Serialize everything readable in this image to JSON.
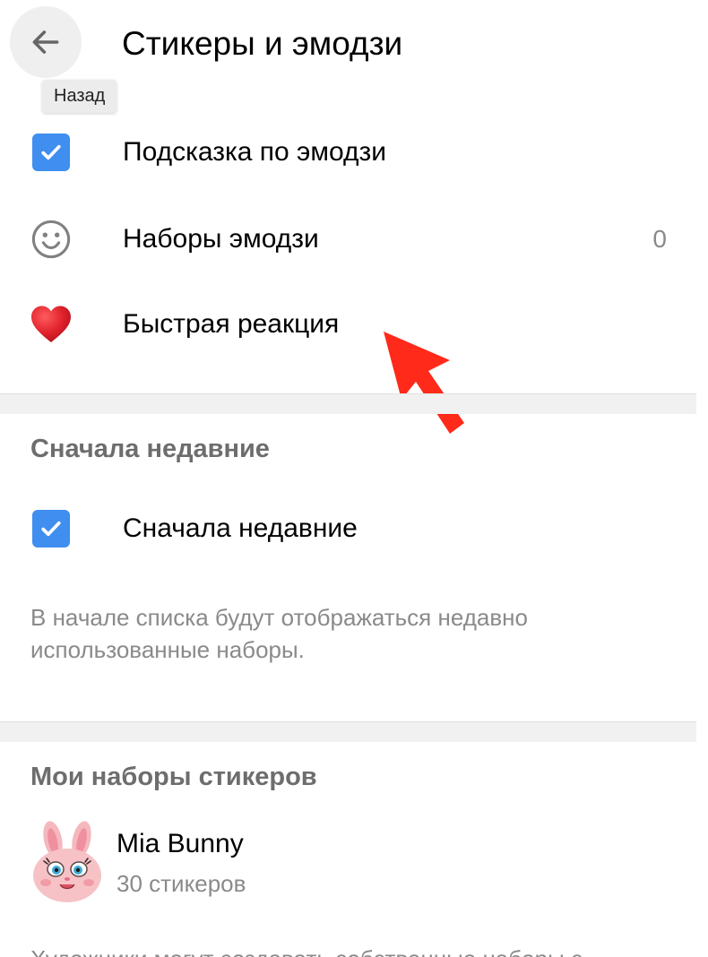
{
  "header": {
    "title": "Стикеры и эмодзи",
    "back_tooltip": "Назад"
  },
  "emoji_section": {
    "items": [
      {
        "label": "Подсказка по эмодзи",
        "checked": true,
        "icon": "checkbox-icon"
      },
      {
        "label": "Наборы эмодзи",
        "count": "0",
        "icon": "smiley-icon"
      },
      {
        "label": "Быстрая реакция",
        "icon": "heart-icon"
      }
    ]
  },
  "recent_section": {
    "header": "Сначала недавние",
    "toggle_label": "Сначала недавние",
    "checked": true,
    "description": "В начале списка будут отображаться недавно использованные наборы."
  },
  "stickers_section": {
    "header": "Мои наборы стикеров",
    "packs": [
      {
        "name": "Mia Bunny",
        "count": "30 стикеров"
      }
    ],
    "footer_text": "Художники могут создавать собственные наборы с"
  },
  "colors": {
    "accent": "#3f8ef0",
    "heart": "#e0222b",
    "annotation_arrow": "#ff2a1a",
    "section_bg": "#f1f1f1",
    "secondary_text": "#8a8a8a"
  }
}
